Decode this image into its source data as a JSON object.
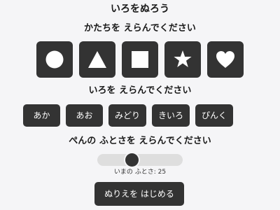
{
  "app": {
    "title": "いろをぬろう"
  },
  "shapes": {
    "label": "かたちを えらんでください",
    "items": [
      {
        "name": "circle-icon"
      },
      {
        "name": "triangle-icon"
      },
      {
        "name": "square-icon"
      },
      {
        "name": "star-icon"
      },
      {
        "name": "heart-icon"
      }
    ]
  },
  "colors": {
    "label": "いろを えらんでください",
    "items": [
      {
        "label": "あか"
      },
      {
        "label": "あお"
      },
      {
        "label": "みどり"
      },
      {
        "label": "きいろ"
      },
      {
        "label": "ぴんく"
      }
    ]
  },
  "pen": {
    "label": "ぺんの ふとさを えらんでください",
    "size": 25,
    "readout": "いまの ふとさ: 25"
  },
  "start": {
    "label": "ぬりえを はじめる"
  },
  "theme": {
    "button_bg": "#333333",
    "button_fg": "#ffffff",
    "page_bg": "#f5f5f7",
    "track": "#dedede"
  }
}
